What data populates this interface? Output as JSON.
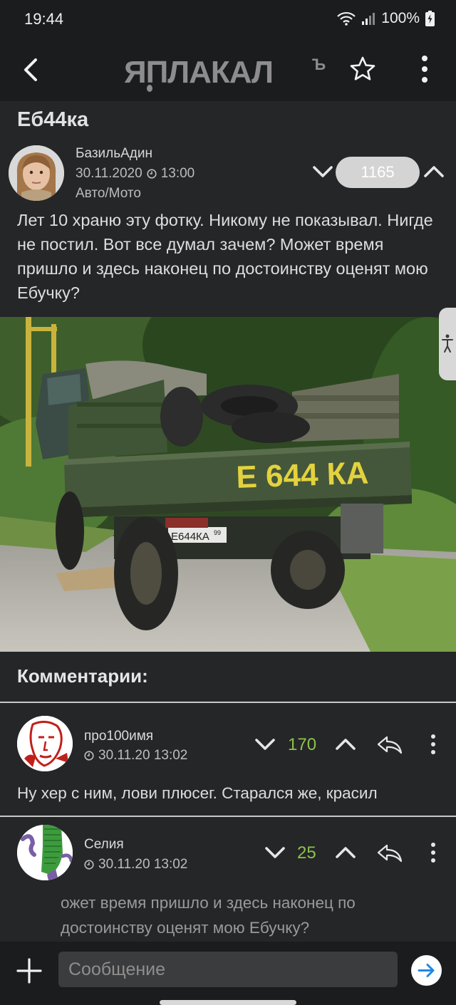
{
  "status_bar": {
    "time": "19:44",
    "battery": "100%"
  },
  "header": {
    "logo_text": "ЯПЛАКАЛЪ"
  },
  "post": {
    "title": "Еб44ка",
    "author": "БазильАдин",
    "date": "30.11.2020",
    "time": "13:00",
    "category": "Авто/Мото",
    "rating": "1165",
    "body": "Лет 10 храню эту фотку. Никому не показывал. Нигде не постил. Вот все думал зачем? Может время пришло и здесь наконец по достоинству оценят мою Ебучку?",
    "image": {
      "painted_text": "Е 644 КА",
      "plate_text": "Е644КА",
      "plate_region": "99"
    }
  },
  "comments": {
    "header": "Комментарии:",
    "items": [
      {
        "author": "про100имя",
        "datetime": "30.11.20 13:02",
        "score": "170",
        "text": "Ну хер с ним, лови плюсег. Старался же, красил"
      },
      {
        "author": "Селия",
        "datetime": "30.11.20 13:02",
        "score": "25",
        "quote": "ожет время пришло и здесь наконец по достоинству оценят мою Ебучку?"
      }
    ]
  },
  "composer": {
    "placeholder": "Сообщение"
  },
  "colors": {
    "background": "#252628",
    "bar": "#1b1c1e",
    "score_green": "#8bc34a",
    "rating_pill": "#d4d4d4",
    "accent_blue": "#1e88e5"
  },
  "icons": [
    "back-arrow-icon",
    "star-icon",
    "more-vert-icon",
    "clock-icon",
    "chevron-down-icon",
    "chevron-up-icon",
    "reply-icon",
    "plus-icon",
    "send-icon",
    "accessibility-icon",
    "wifi-icon",
    "signal-icon",
    "battery-icon"
  ]
}
